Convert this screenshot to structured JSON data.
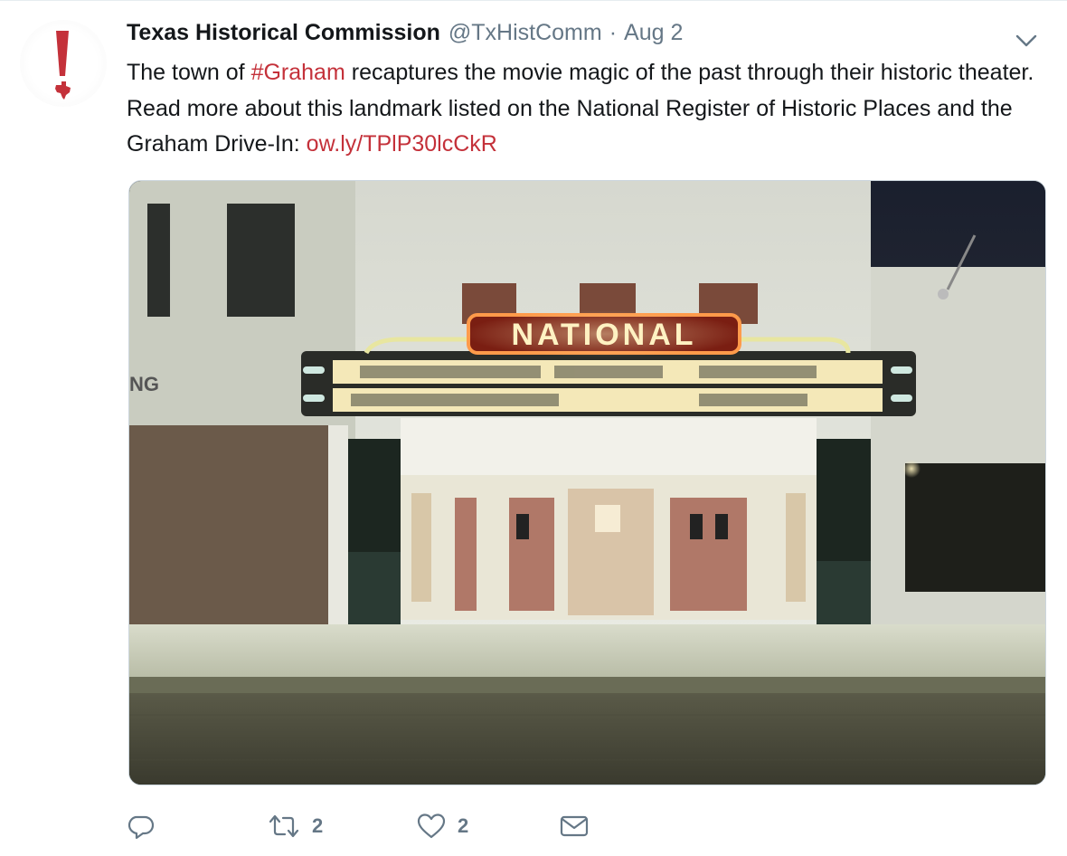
{
  "tweet": {
    "author_name": "Texas Historical Commission",
    "handle": "@TxHistComm",
    "separator": "·",
    "date": "Aug 2",
    "text_before_hashtag": "The town of ",
    "hashtag": "#Graham",
    "text_after_hashtag": " recaptures the movie magic of the past through their historic theater. Read more about this landmark listed on the National Register of Historic Places and the Graham Drive-In: ",
    "link": "ow.ly/TPlP30lcCkR",
    "image": {
      "marquee_sign": "NATIONAL"
    }
  },
  "actions": {
    "reply_icon": "reply-icon",
    "retweet_icon": "retweet-icon",
    "retweet_count": "2",
    "like_icon": "heart-icon",
    "like_count": "2",
    "dm_icon": "envelope-icon"
  },
  "colors": {
    "brand_red": "#c4313a",
    "text_primary": "#14171a",
    "text_secondary": "#657786",
    "divider": "#e6ecf0"
  }
}
